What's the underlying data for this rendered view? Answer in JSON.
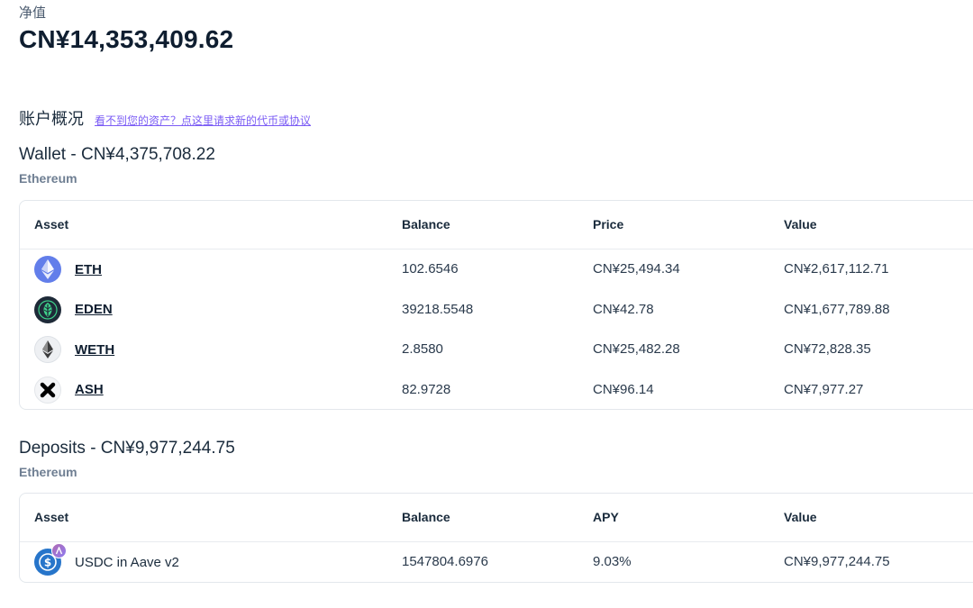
{
  "networth": {
    "label": "净值",
    "value": "CN¥14,353,409.62"
  },
  "overview": {
    "title": "账户概况",
    "link": "看不到您的资产？点这里请求新的代币或协议"
  },
  "wallet": {
    "title": "Wallet - CN¥4,375,708.22",
    "network": "Ethereum",
    "headers": [
      "Asset",
      "Balance",
      "Price",
      "Value"
    ],
    "rows": [
      {
        "asset": "ETH",
        "icon": "eth-icon",
        "balance": "102.6546",
        "price": "CN¥25,494.34",
        "value": "CN¥2,617,112.71"
      },
      {
        "asset": "EDEN",
        "icon": "eden-icon",
        "balance": "39218.5548",
        "price": "CN¥42.78",
        "value": "CN¥1,677,789.88"
      },
      {
        "asset": "WETH",
        "icon": "weth-icon",
        "balance": "2.8580",
        "price": "CN¥25,482.28",
        "value": "CN¥72,828.35"
      },
      {
        "asset": "ASH",
        "icon": "ash-icon",
        "balance": "82.9728",
        "price": "CN¥96.14",
        "value": "CN¥7,977.27"
      }
    ]
  },
  "deposits": {
    "title": "Deposits - CN¥9,977,244.75",
    "network": "Ethereum",
    "headers": [
      "Asset",
      "Balance",
      "APY",
      "Value"
    ],
    "rows": [
      {
        "asset": "USDC in Aave v2",
        "icon": "usdc-icon",
        "balance": "1547804.6976",
        "apy": "9.03%",
        "value": "CN¥9,977,244.75"
      }
    ]
  },
  "colors": {
    "link": "#7b5cf5",
    "eth": "#627eea",
    "eden": "#1e2a38",
    "usdc": "#2775ca"
  }
}
